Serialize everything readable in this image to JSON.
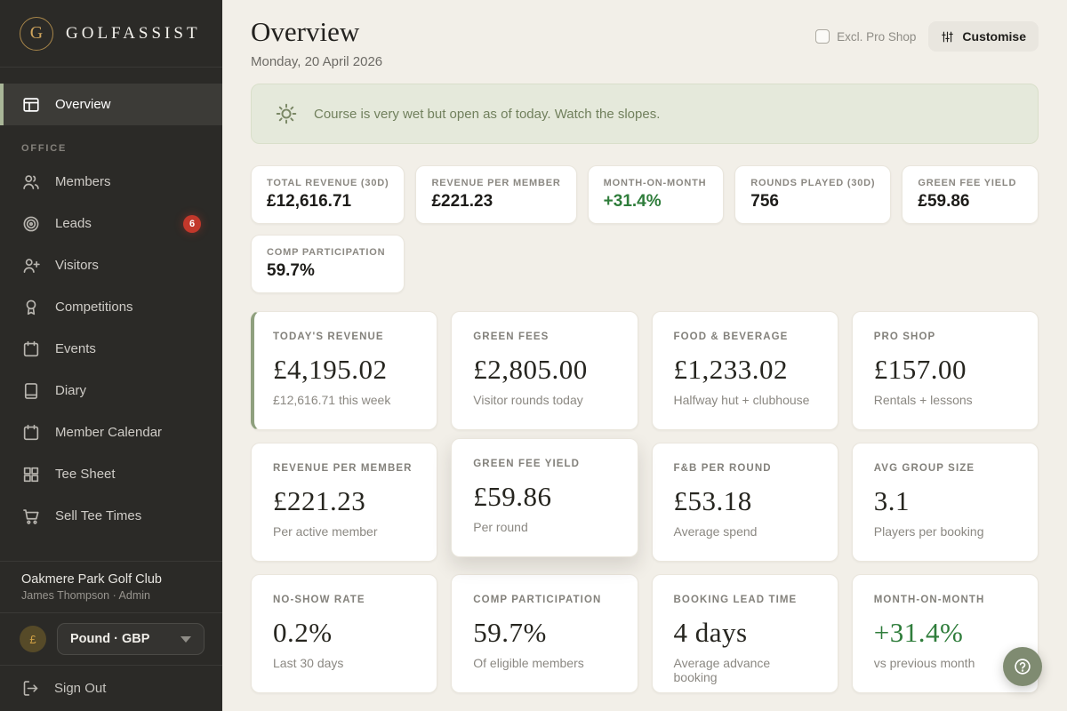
{
  "brand": {
    "monogram": "G",
    "name": "GOLFASSIST"
  },
  "sidebar": {
    "overview_label": "Overview",
    "section_label": "OFFICE",
    "items": [
      {
        "label": "Members",
        "icon": "members-icon"
      },
      {
        "label": "Leads",
        "icon": "target-icon",
        "badge": "6"
      },
      {
        "label": "Visitors",
        "icon": "person-add-icon"
      },
      {
        "label": "Competitions",
        "icon": "award-icon"
      },
      {
        "label": "Events",
        "icon": "calendar-icon"
      },
      {
        "label": "Diary",
        "icon": "book-icon"
      },
      {
        "label": "Member Calendar",
        "icon": "calendar-icon"
      },
      {
        "label": "Tee Sheet",
        "icon": "grid-icon"
      },
      {
        "label": "Sell Tee Times",
        "icon": "cart-icon"
      }
    ],
    "club": {
      "name": "Oakmere Park Golf Club",
      "user": "James Thompson · Admin"
    },
    "currency": {
      "symbol": "£",
      "selected": "Pound · GBP"
    },
    "sign_out_label": "Sign Out"
  },
  "header": {
    "title": "Overview",
    "date": "Monday, 20 April 2026",
    "excl_pro_shop_label": "Excl. Pro Shop",
    "excl_pro_shop_checked": false,
    "customise_label": "Customise"
  },
  "banner": {
    "message": "Course is very wet but open as of today. Watch the slopes."
  },
  "mini_stats": [
    {
      "label": "TOTAL REVENUE (30D)",
      "value": "£12,616.71"
    },
    {
      "label": "REVENUE PER MEMBER",
      "value": "£221.23"
    },
    {
      "label": "MONTH-ON-MONTH",
      "value": "+31.4%",
      "positive": true
    },
    {
      "label": "ROUNDS PLAYED (30D)",
      "value": "756"
    },
    {
      "label": "GREEN FEE YIELD",
      "value": "£59.86"
    },
    {
      "label": "COMP PARTICIPATION",
      "value": "59.7%"
    }
  ],
  "stat_cards": [
    {
      "label": "TODAY'S REVENUE",
      "value": "£4,195.02",
      "sub": "£12,616.71 this week",
      "accent": true
    },
    {
      "label": "GREEN FEES",
      "value": "£2,805.00",
      "sub": "Visitor rounds today"
    },
    {
      "label": "FOOD & BEVERAGE",
      "value": "£1,233.02",
      "sub": "Halfway hut + clubhouse"
    },
    {
      "label": "PRO SHOP",
      "value": "£157.00",
      "sub": "Rentals + lessons"
    },
    {
      "label": "REVENUE PER MEMBER",
      "value": "£221.23",
      "sub": "Per active member"
    },
    {
      "label": "GREEN FEE YIELD",
      "value": "£59.86",
      "sub": "Per round",
      "elevated": true
    },
    {
      "label": "F&B PER ROUND",
      "value": "£53.18",
      "sub": "Average spend"
    },
    {
      "label": "AVG GROUP SIZE",
      "value": "3.1",
      "sub": "Players per booking"
    },
    {
      "label": "NO-SHOW RATE",
      "value": "0.2%",
      "sub": "Last 30 days"
    },
    {
      "label": "COMP PARTICIPATION",
      "value": "59.7%",
      "sub": "Of eligible members"
    },
    {
      "label": "BOOKING LEAD TIME",
      "value": "4 days",
      "sub": "Average advance booking"
    },
    {
      "label": "MONTH-ON-MONTH",
      "value": "+31.4%",
      "sub": "vs previous month",
      "positive": true
    }
  ],
  "colors": {
    "sidebar_bg": "#2b2a27",
    "accent_sage": "#a9b698",
    "gold": "#cfa45c",
    "positive_green": "#2f7d3b",
    "badge_red": "#c2382b",
    "main_bg": "#f2efe8",
    "banner_bg": "#e5e9db",
    "fab_bg": "#7f8b71"
  }
}
